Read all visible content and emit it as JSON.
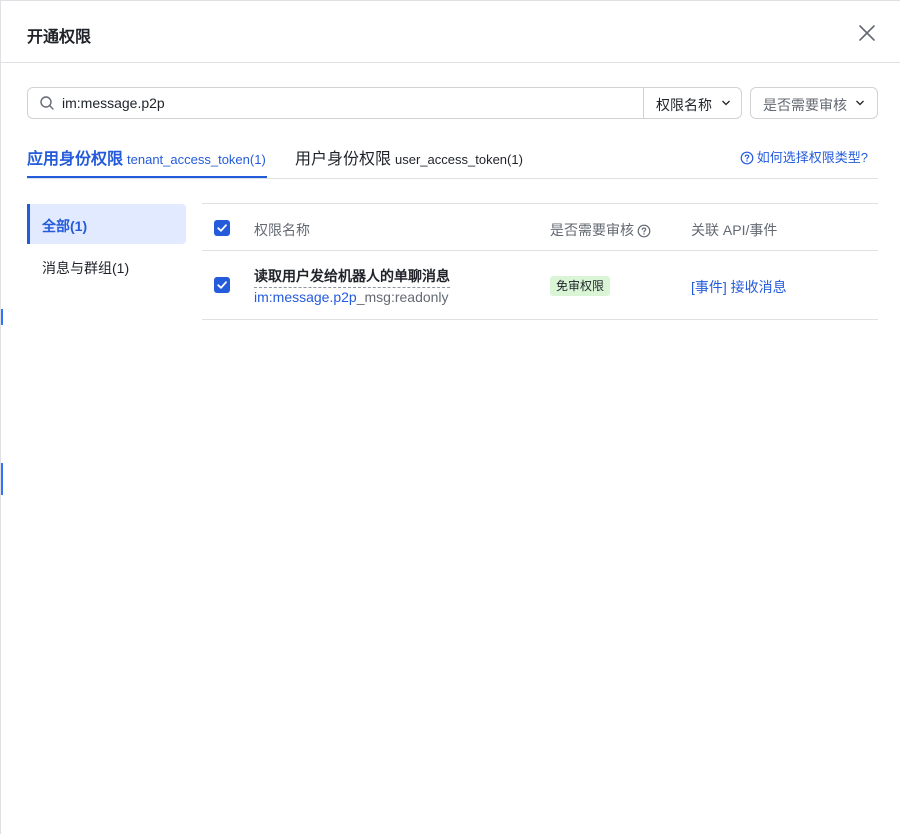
{
  "dialog": {
    "title": "开通权限"
  },
  "search": {
    "value": "im:message.p2p",
    "placeholder": ""
  },
  "filters": {
    "permission_name": "权限名称",
    "review_required": "是否需要审核"
  },
  "tabs": [
    {
      "label": "应用身份权限",
      "token": "tenant_access_token(1)",
      "active": true
    },
    {
      "label": "用户身份权限",
      "token": "user_access_token(1)",
      "active": false
    }
  ],
  "help_link": "如何选择权限类型?",
  "sidebar": {
    "items": [
      {
        "label": "全部(1)",
        "active": true
      },
      {
        "label": "消息与群组(1)",
        "active": false
      }
    ]
  },
  "table": {
    "headers": {
      "name": "权限名称",
      "review": "是否需要审核",
      "related": "关联 API/事件"
    },
    "rows": [
      {
        "checked": true,
        "name": "读取用户发给机器人的单聊消息",
        "code_highlight": "im:message.p2p",
        "code_rest": "_msg:readonly",
        "badge": "免审权限",
        "related": "[事件] 接收消息"
      }
    ]
  },
  "colors": {
    "accent": "#245bdb",
    "badge_bg": "#d9f5d6",
    "active_bg": "#e1eaff"
  },
  "icons": {
    "close": "close-icon",
    "search": "search-icon",
    "chevron": "chevron-down-icon",
    "help": "question-circle-icon",
    "check": "checkmark-icon"
  }
}
